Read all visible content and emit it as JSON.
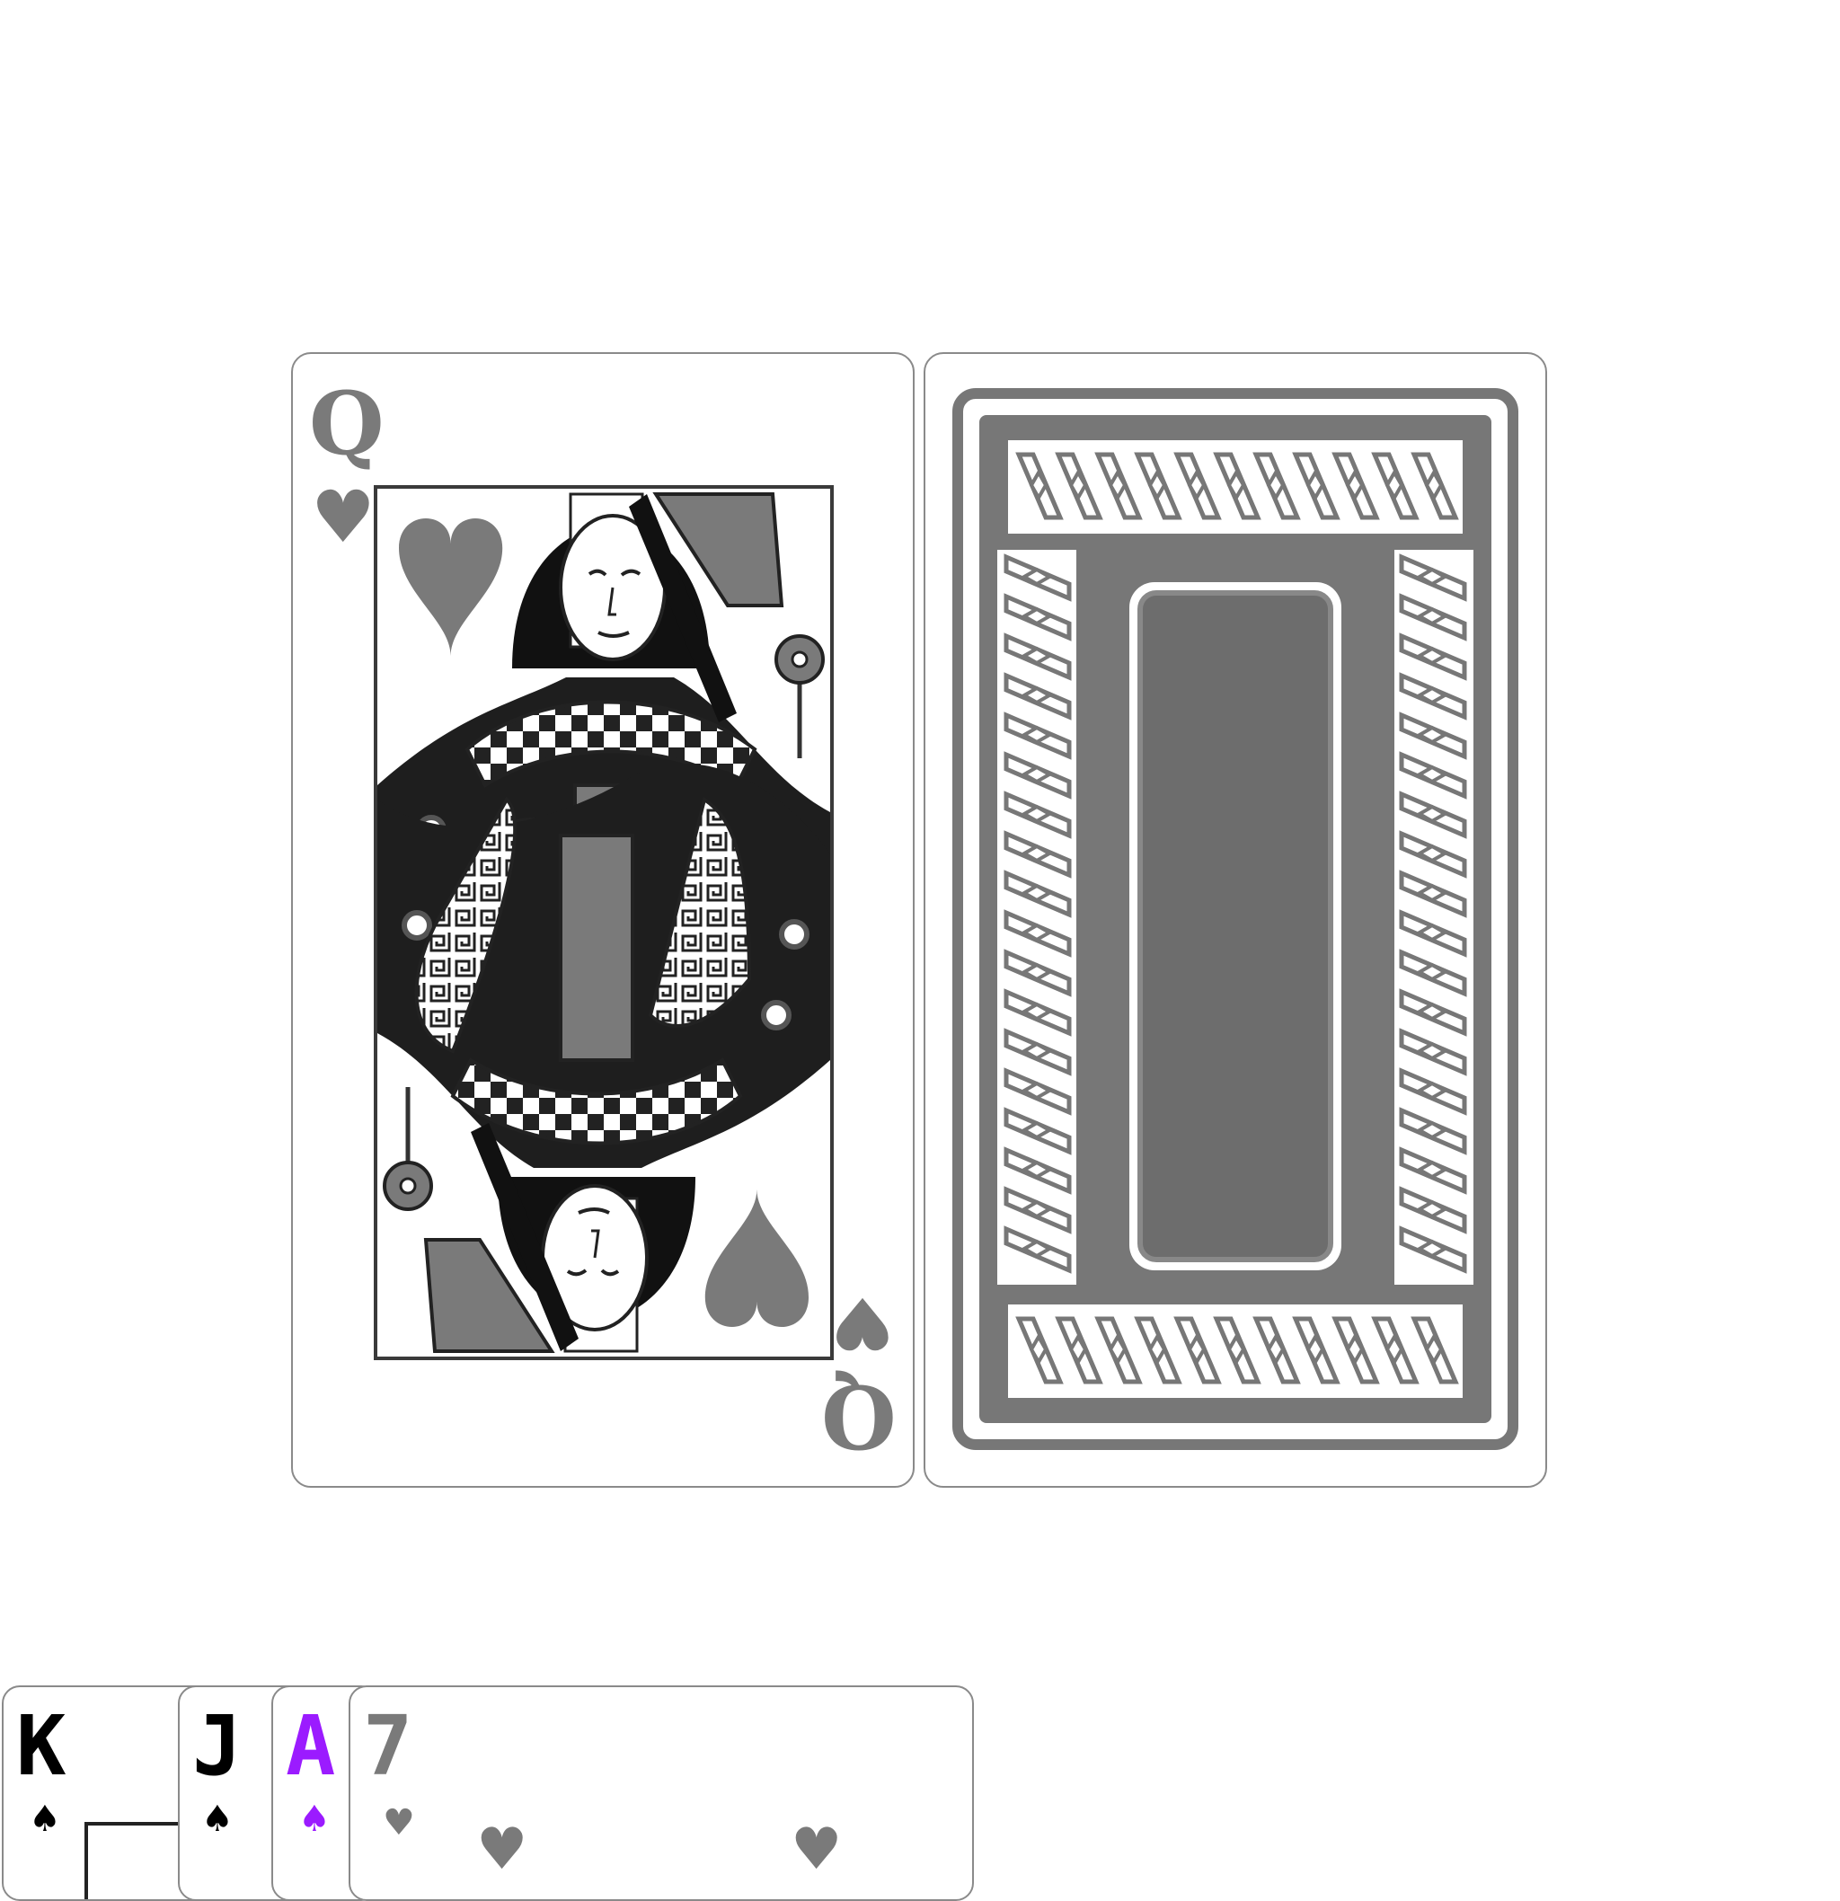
{
  "table": {
    "face_card": {
      "rank": "Q",
      "suit": "♥",
      "suit_name": "hearts",
      "color": "#7a7a7a"
    },
    "back_card": {
      "pattern": "braided-border-back",
      "color": "#777777"
    }
  },
  "hand": {
    "cards": [
      {
        "rank": "K",
        "suit": "♠",
        "color": "#000000"
      },
      {
        "rank": "J",
        "suit": "♠",
        "color": "#000000"
      },
      {
        "rank": "A",
        "suit": "♠",
        "color": "#9b1bff"
      },
      {
        "rank": "7",
        "suit": "♥",
        "color": "#7a7a7a"
      }
    ]
  },
  "icons": {
    "heart": "heart-icon",
    "spade": "spade-icon",
    "flower": "flower-icon"
  }
}
